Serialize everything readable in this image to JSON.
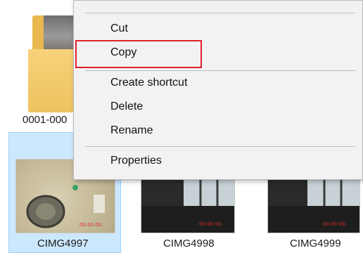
{
  "files": [
    {
      "name": "0001-000",
      "kind": "folder"
    },
    {
      "name": "CIMG4997",
      "kind": "image",
      "selected": true
    },
    {
      "name": "CIMG4998",
      "kind": "image"
    },
    {
      "name": "CIMG4999",
      "kind": "image"
    }
  ],
  "context_menu": {
    "items": [
      "Cut",
      "Copy",
      "Create shortcut",
      "Delete",
      "Rename",
      "Properties"
    ],
    "highlighted": "Copy"
  },
  "colors": {
    "selection_fill": "#cce8ff",
    "selection_border": "#99d1ff",
    "highlight_box": "#e0212f",
    "menu_bg": "#f2f2f2"
  }
}
